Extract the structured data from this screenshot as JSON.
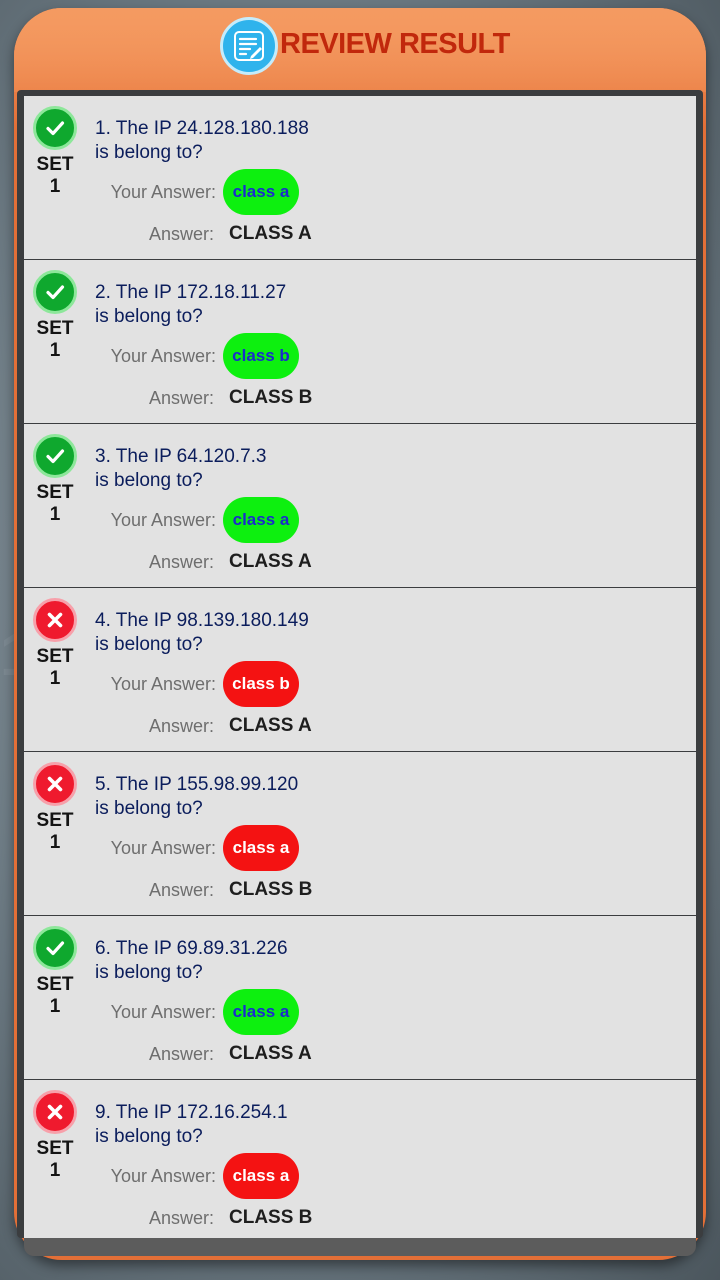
{
  "header": {
    "title": "REVIEW RESULT",
    "icon": "notes-edit-icon"
  },
  "colors": {
    "frame": "#e36f37",
    "title": "#c1280c",
    "correct": "#0df00f",
    "wrong": "#f41212"
  },
  "labels": {
    "your_answer": "Your Answer:",
    "answer": "Answer:"
  },
  "questions": [
    {
      "set": "SET 1",
      "line1": "1. The IP 24.128.180.188",
      "line2": "is belong to?",
      "your_answer": "class a",
      "answer": "CLASS A",
      "correct": true
    },
    {
      "set": "SET 1",
      "line1": "2. The IP 172.18.11.27",
      "line2": "is belong to?",
      "your_answer": "class b",
      "answer": "CLASS B",
      "correct": true
    },
    {
      "set": "SET 1",
      "line1": "3. The IP 64.120.7.3",
      "line2": "is belong to?",
      "your_answer": "class a",
      "answer": "CLASS A",
      "correct": true
    },
    {
      "set": "SET 1",
      "line1": "4. The IP 98.139.180.149",
      "line2": "is belong to?",
      "your_answer": "class b",
      "answer": "CLASS A",
      "correct": false
    },
    {
      "set": "SET 1",
      "line1": "5. The IP 155.98.99.120",
      "line2": "is belong to?",
      "your_answer": "class a",
      "answer": "CLASS B",
      "correct": false
    },
    {
      "set": "SET 1",
      "line1": "6. The IP 69.89.31.226",
      "line2": "is belong to?",
      "your_answer": "class a",
      "answer": "CLASS A",
      "correct": true
    },
    {
      "set": "SET 1",
      "line1": "9. The IP 172.16.254.1",
      "line2": "is belong to?",
      "your_answer": "class a",
      "answer": "CLASS B",
      "correct": false
    }
  ]
}
